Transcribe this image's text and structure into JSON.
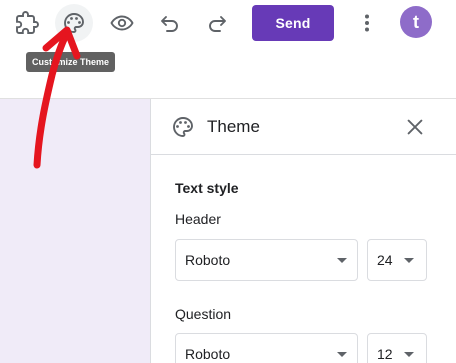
{
  "toolbar": {
    "send_label": "Send",
    "avatar_letter": "t",
    "tooltip_text": "Customize Theme",
    "icons": [
      "add-ons-icon",
      "palette-icon",
      "preview-eye-icon",
      "undo-icon",
      "redo-icon",
      "more-vert-icon"
    ]
  },
  "panel": {
    "title": "Theme",
    "text_style_label": "Text style",
    "header": {
      "label": "Header",
      "font": "Roboto",
      "size": "24"
    },
    "question": {
      "label": "Question",
      "font": "Roboto",
      "size": "12"
    }
  },
  "colors": {
    "accent": "#673ab7",
    "avatar": "#8e6cc9",
    "canvas": "#f0ebf8",
    "annotation_arrow": "#e5151f"
  }
}
